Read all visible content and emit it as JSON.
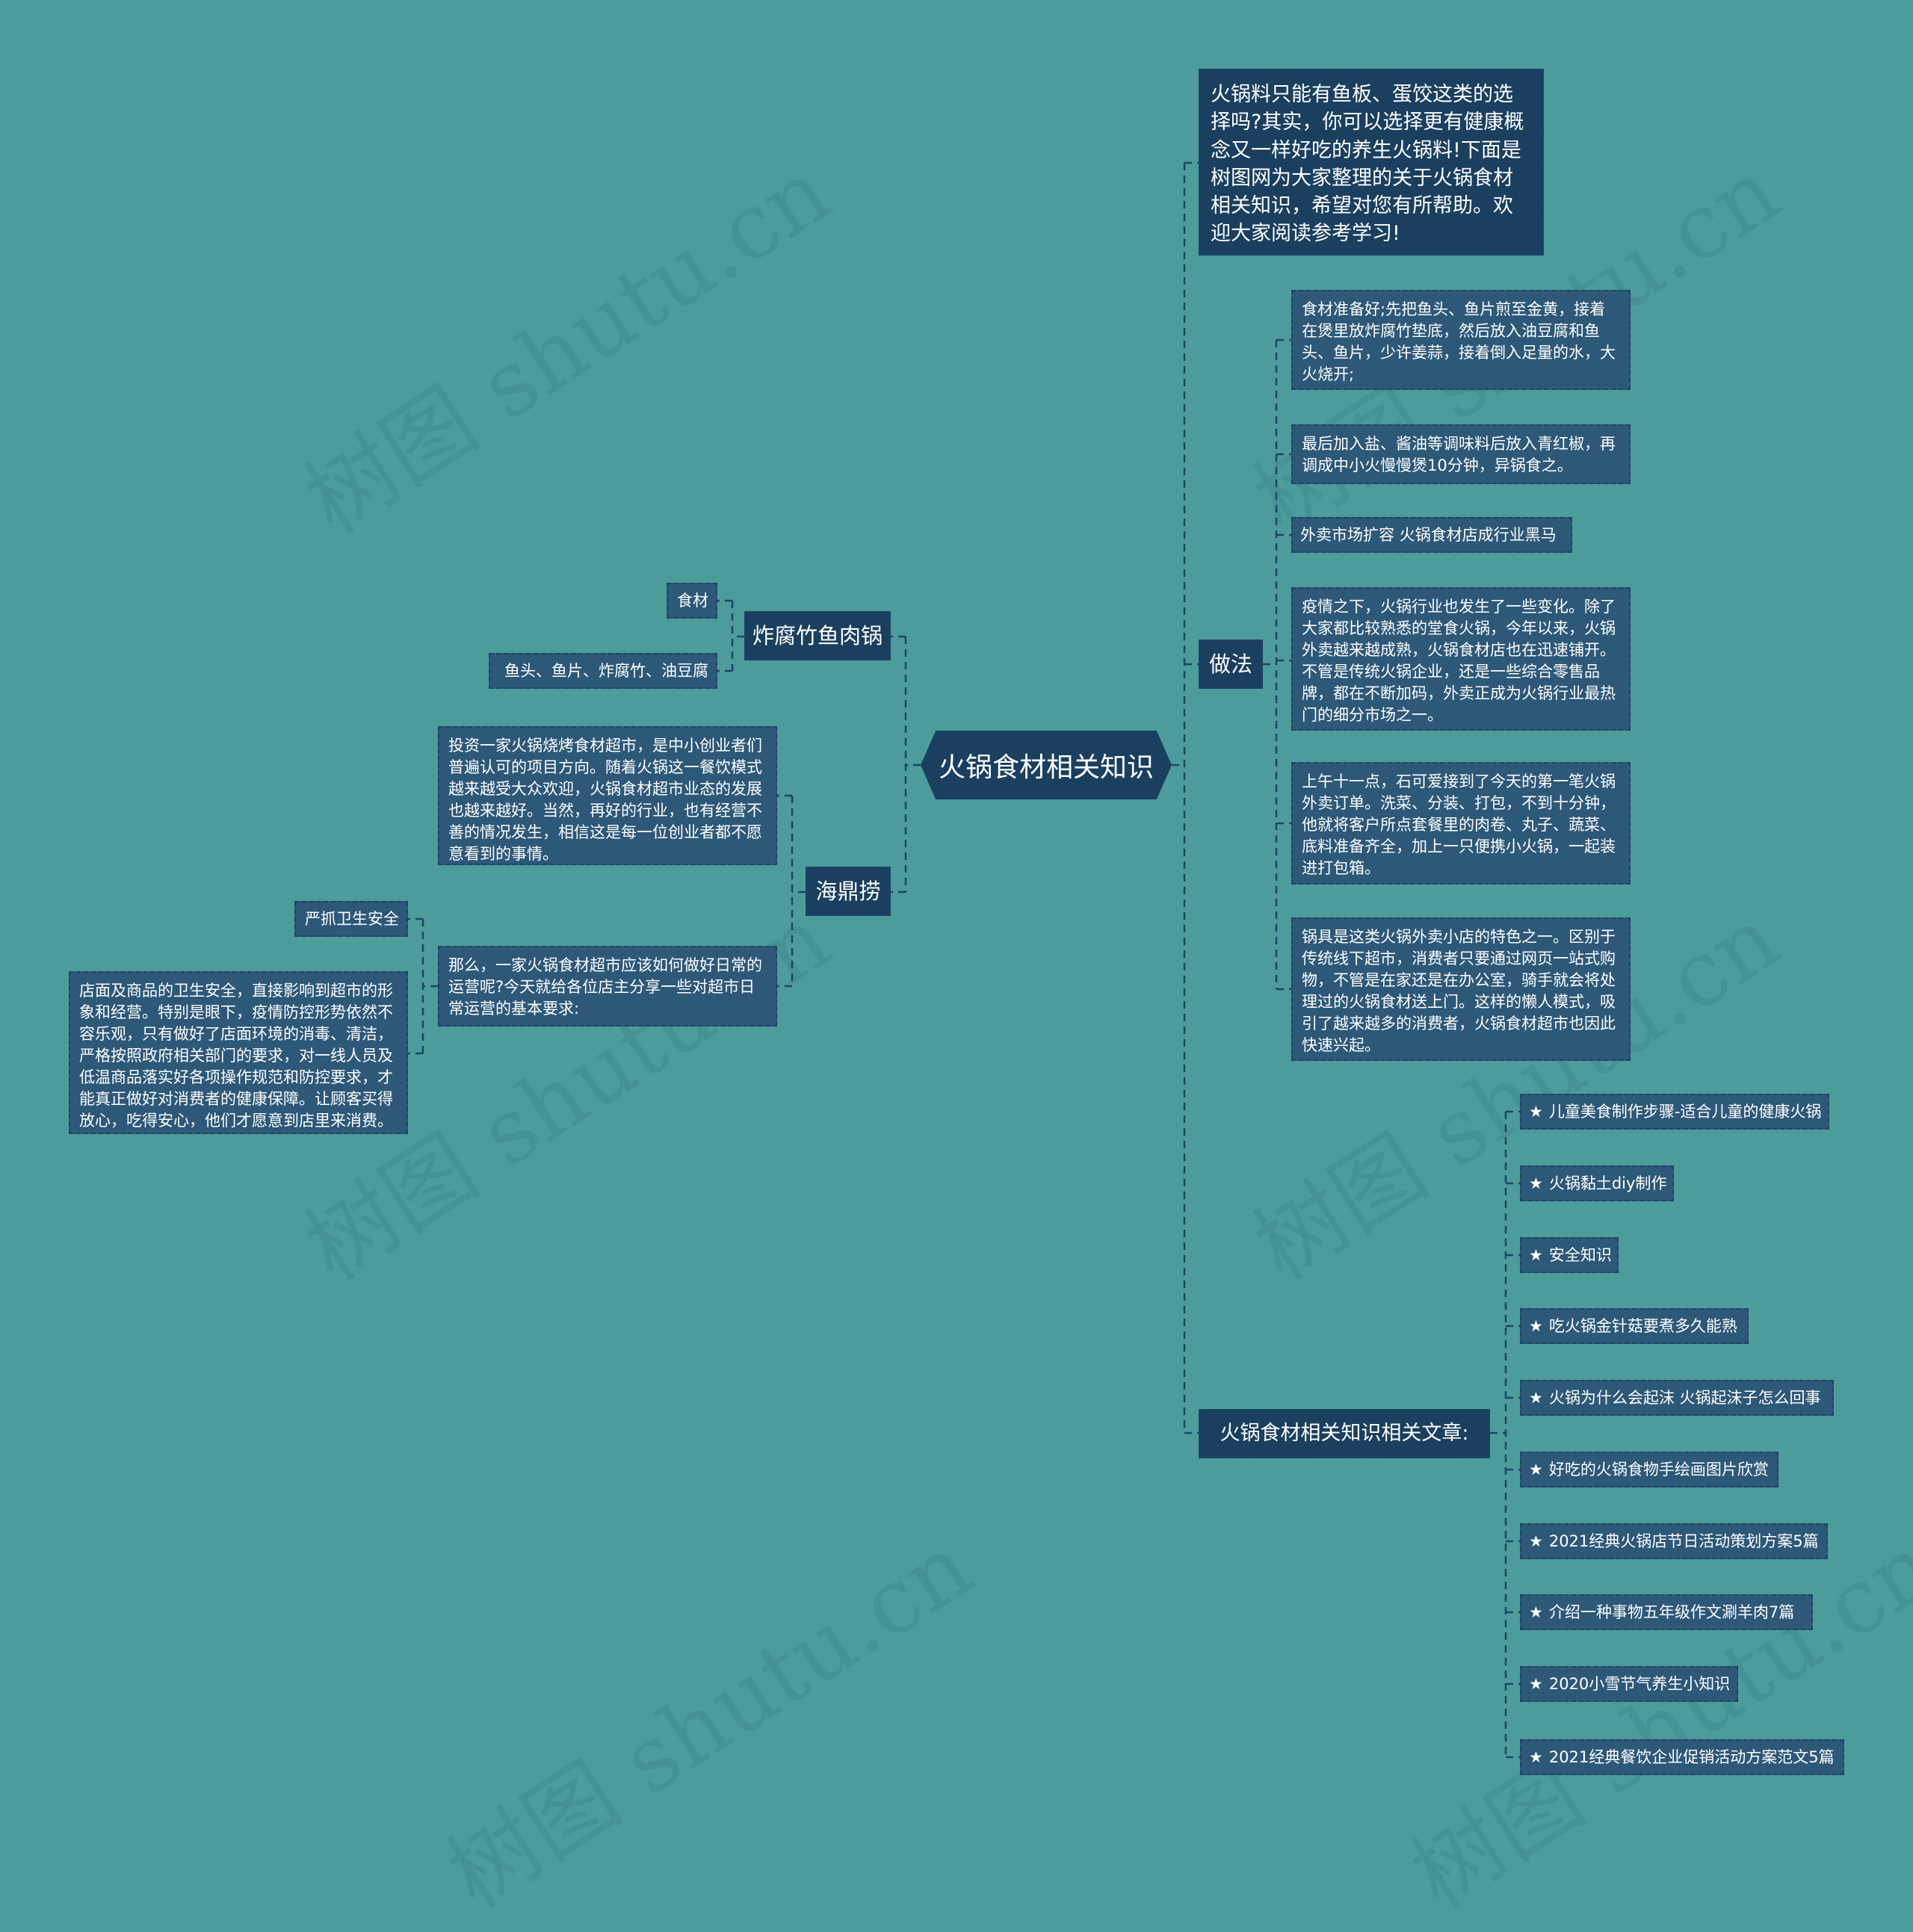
{
  "watermark": "树图 shutu.cn",
  "root": {
    "label": "火锅食材相关知识"
  },
  "right": {
    "intro": "火锅料只能有鱼板、蛋饺这类的选择吗?其实，你可以选择更有健康概念又一样好吃的养生火锅料!下面是树图网为大家整理的关于火锅食材相关知识，希望对您有所帮助。欢迎大家阅读参考学习!",
    "method": {
      "label": "做法",
      "children": [
        "食材准备好;先把鱼头、鱼片煎至金黄，接着在煲里放炸腐竹垫底，然后放入油豆腐和鱼头、鱼片，少许姜蒜，接着倒入足量的水，大火烧开;",
        "最后加入盐、酱油等调味料后放入青红椒，再调成中小火慢慢煲10分钟，异锅食之。",
        "外卖市场扩容 火锅食材店成行业黑马",
        "疫情之下，火锅行业也发生了一些变化。除了大家都比较熟悉的堂食火锅，今年以来，火锅外卖越来越成熟，火锅食材店也在迅速铺开。不管是传统火锅企业，还是一些综合零售品牌，都在不断加码，外卖正成为火锅行业最热门的细分市场之一。",
        "上午十一点，石可爱接到了今天的第一笔火锅外卖订单。洗菜、分装、打包，不到十分钟，他就将客户所点套餐里的肉卷、丸子、蔬菜、底料准备齐全，加上一只便携小火锅，一起装进打包箱。",
        "锅具是这类火锅外卖小店的特色之一。区别于传统线下超市，消费者只要通过网页一站式购物，不管是在家还是在办公室，骑手就会将处理过的火锅食材送上门。这样的懒人模式，吸引了越来越多的消费者，火锅食材超市也因此快速兴起。"
      ]
    },
    "articles": {
      "label": "火锅食材相关知识相关文章:",
      "star": "★",
      "items": [
        "儿童美食制作步骤-适合儿童的健康火锅",
        "火锅黏土diy制作",
        "安全知识",
        "吃火锅金针菇要煮多久能熟",
        "火锅为什么会起沫 火锅起沫子怎么回事",
        "好吃的火锅食物手绘画图片欣赏",
        "2021经典火锅店节日活动策划方案5篇",
        "介绍一种事物五年级作文涮羊肉7篇",
        "2020小雪节气养生小知识",
        "2021经典餐饮企业促销活动方案范文5篇"
      ]
    }
  },
  "left": {
    "zhafuzhu": {
      "label": "炸腐竹鱼肉锅",
      "children": [
        "食材",
        "鱼头、鱼片、炸腐竹、油豆腐"
      ]
    },
    "haidilao": {
      "label": "海鼎捞",
      "children": [
        "投资一家火锅烧烤食材超市，是中小创业者们普遍认可的项目方向。随着火锅这一餐饮模式越来越受大众欢迎，火锅食材超市业态的发展也越来越好。当然，再好的行业，也有经营不善的情况发生，相信这是每一位创业者都不愿意看到的事情。",
        "那么，一家火锅食材超市应该如何做好日常的运营呢?今天就给各位店主分享一些对超市日常运营的基本要求:"
      ],
      "sub": {
        "label": "严抓卫生安全",
        "detail": "店面及商品的卫生安全，直接影响到超市的形象和经营。特别是眼下，疫情防控形势依然不容乐观，只有做好了店面环境的消毒、清洁，严格按照政府相关部门的要求，对一线人员及低温商品落实好各项操作规范和防控要求，才能真正做好对消费者的健康保障。让顾客买得放心，吃得安心，他们才愿意到店里来消费。"
      }
    }
  }
}
